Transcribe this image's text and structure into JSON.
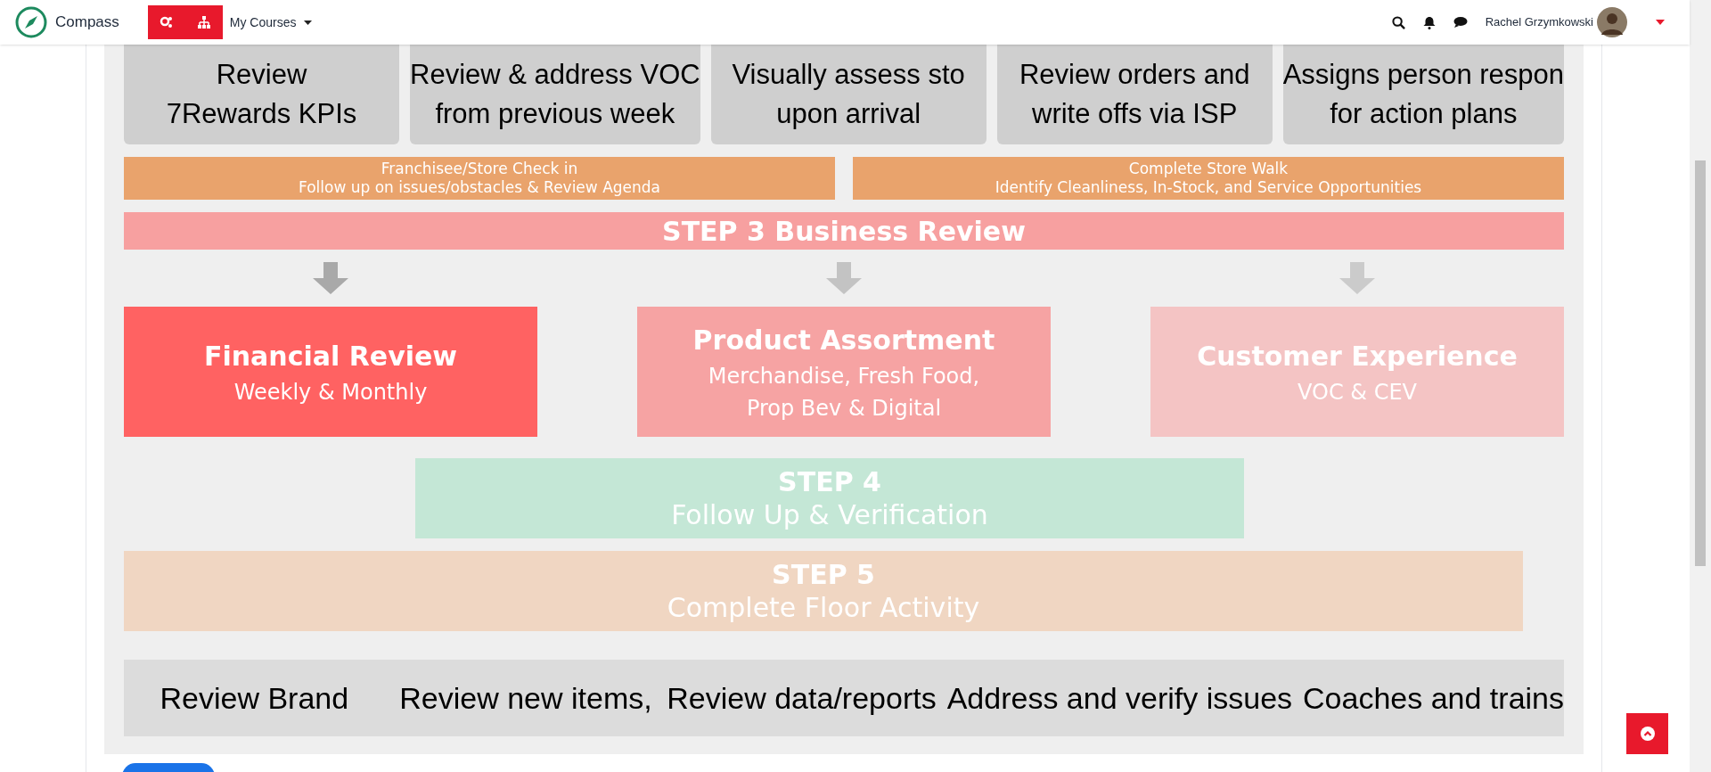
{
  "navbar": {
    "brand": "Compass",
    "menu": "My Courses",
    "user": "Rachel Grzymkowski"
  },
  "diagram": {
    "top_notes": [
      {
        "lines": [
          "Review",
          "7Rewards KPIs"
        ]
      },
      {
        "lines": [
          "Review & address VOC",
          "from previous week"
        ]
      },
      {
        "lines": [
          "Visually assess sto",
          "upon arrival"
        ]
      },
      {
        "lines": [
          "Review orders and",
          "write offs via ISP"
        ]
      },
      {
        "lines": [
          "Assigns person respon",
          "for action plans"
        ]
      }
    ],
    "check_steps": [
      {
        "title": "Franchisee/Store Check in",
        "subtitle": "Follow up on issues/obstacles & Review Agenda"
      },
      {
        "title": "Complete Store Walk",
        "subtitle": "Identify Cleanliness, In-Stock, and Service Opportunities"
      }
    ],
    "business_review": "STEP 3 Business Review",
    "focus_areas": [
      {
        "title": "Financial Review",
        "lines": [
          "Weekly & Monthly"
        ],
        "color": "#ff6262"
      },
      {
        "title": "Product Assortment",
        "lines": [
          "Merchandise, Fresh Food,",
          "Prop Bev & Digital"
        ],
        "color": "#f6a3a3"
      },
      {
        "title": "Customer Experience",
        "lines": [
          "VOC & CEV"
        ],
        "color": "#f4c4c4"
      }
    ],
    "step4": [
      "STEP 4",
      "Follow Up & Verification"
    ],
    "step5": [
      "STEP 5",
      "Complete Floor Activity"
    ],
    "bottom_notes": [
      "Review Brand",
      "Review new items,",
      "Review data/reports",
      "Address and verify issues",
      "Coaches and trains"
    ]
  }
}
